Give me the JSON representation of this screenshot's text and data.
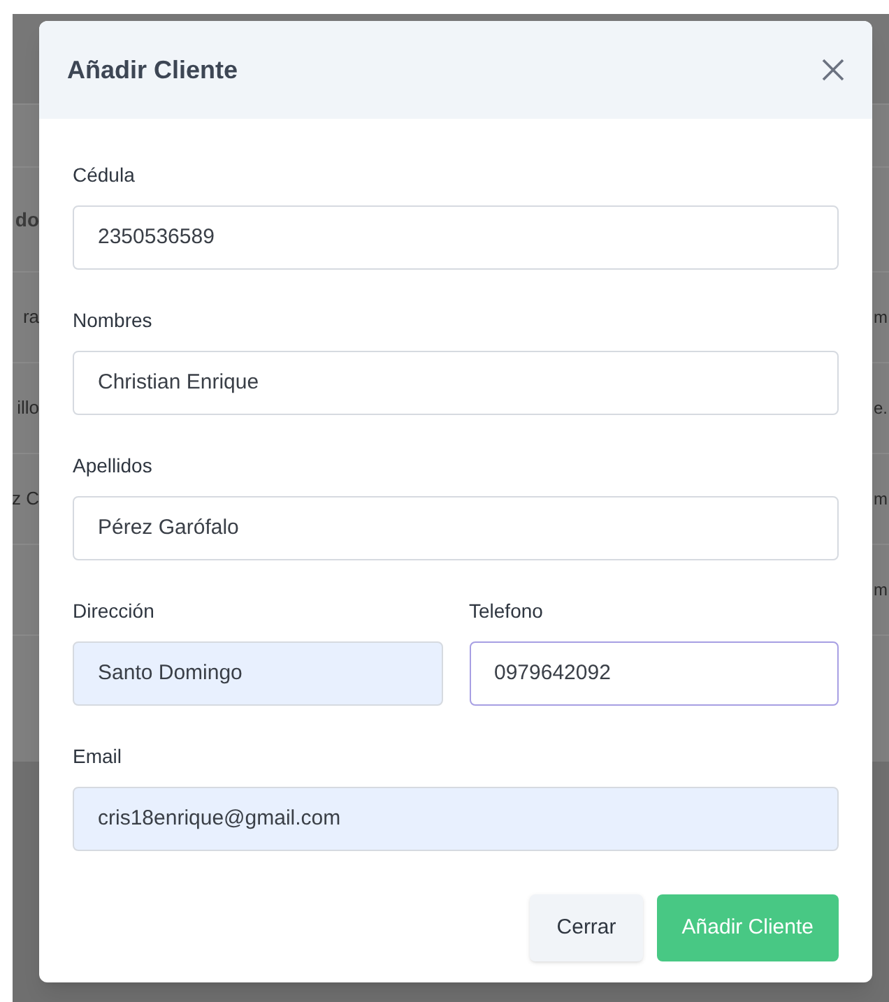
{
  "background": {
    "header_fragment": "do",
    "rows": [
      {
        "left": "ra",
        "right": "m"
      },
      {
        "left": "illo",
        "right": "e."
      },
      {
        "left": "z C",
        "right": "m"
      },
      {
        "right": "m"
      }
    ]
  },
  "modal": {
    "title": "Añadir Cliente",
    "rows": [
      [
        {
          "label": "Cédula",
          "value": "2350536589",
          "autofilled": false,
          "focused": false
        }
      ],
      [
        {
          "label": "Nombres",
          "value": "Christian Enrique",
          "autofilled": false,
          "focused": false
        }
      ],
      [
        {
          "label": "Apellidos",
          "value": "Pérez Garófalo",
          "autofilled": false,
          "focused": false
        }
      ],
      [
        {
          "label": "Dirección",
          "value": "Santo Domingo",
          "autofilled": true,
          "focused": false
        },
        {
          "label": "Telefono",
          "value": "0979642092",
          "autofilled": false,
          "focused": true
        }
      ],
      [
        {
          "label": "Email",
          "value": "cris18enrique@gmail.com",
          "autofilled": true,
          "focused": false
        }
      ]
    ],
    "buttons": [
      {
        "label": "Cerrar",
        "kind": "secondary"
      },
      {
        "label": "Añadir Cliente",
        "kind": "primary"
      }
    ]
  }
}
